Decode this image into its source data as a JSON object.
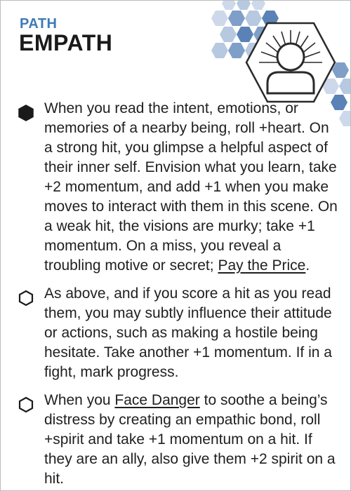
{
  "card": {
    "category": "PATH",
    "title": "EMPATH",
    "colors": {
      "accent": "#3e7ab8",
      "hex_light": "#b6c9e1",
      "hex_mid": "#7f9fc8",
      "hex_dark": "#5a82b6",
      "text": "#1f1f1f"
    },
    "icon": "person-sunburst-icon"
  },
  "abilities": [
    {
      "marked": true,
      "marker_icon": "filled-hexagon-icon",
      "text_before": "When you read the intent, emotions, or memories of a nearby being, roll +heart. On a strong hit, you glimpse a helpful aspect of their inner self. Envision what you learn, take +2 momentum, and add +1 when you make moves to interact with them in this scene. On a weak hit, the visions are murky; take +1 momentum. On a miss, you reveal a troubling motive or secret; ",
      "link": "Pay the Price",
      "text_after": "."
    },
    {
      "marked": false,
      "marker_icon": "empty-hexagon-icon",
      "text": "As above, and if you score a hit as you read them, you may subtly influence their attitude or actions, such as making a hostile being hesitate. Take another +1 momentum. If in a fight, mark progress."
    },
    {
      "marked": false,
      "marker_icon": "empty-hexagon-icon",
      "text_before": "When you ",
      "link": "Face Danger",
      "text_after": " to soothe a being’s distress by creating an empathic bond, roll +spirit and take +1 momentum on a hit. If they are an ally, also give them +2 spirit on a hit."
    }
  ]
}
